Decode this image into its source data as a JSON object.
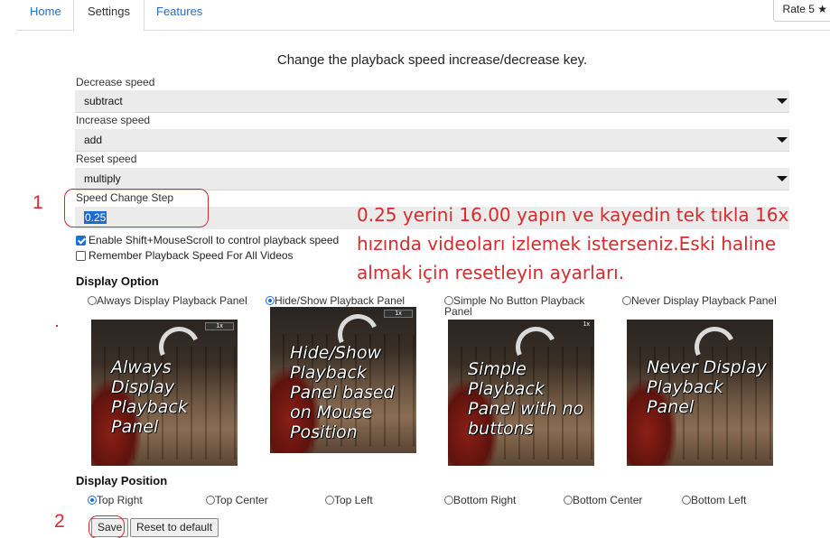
{
  "tabs": [
    {
      "label": "Home"
    },
    {
      "label": "Settings"
    },
    {
      "label": "Features"
    }
  ],
  "rate_button": "Rate 5 ★",
  "heading": "Change the playback speed increase/decrease key.",
  "decrease": {
    "label": "Decrease speed",
    "value": "subtract"
  },
  "increase": {
    "label": "Increase speed",
    "value": "add"
  },
  "reset": {
    "label": "Reset speed",
    "value": "multiply"
  },
  "step": {
    "label": "Speed Change Step",
    "value": "0.25"
  },
  "checkboxes": [
    {
      "label": "Enable Shift+MouseScroll to control playback speed",
      "checked": true
    },
    {
      "label": "Remember Playback Speed For All Videos",
      "checked": false
    }
  ],
  "display_option": {
    "title": "Display Option",
    "options": [
      {
        "label": "Always Display Playback Panel",
        "selected": false,
        "caption": "Always Display Playback Panel"
      },
      {
        "label": "Hide/Show Playback Panel",
        "selected": true,
        "caption": "Hide/Show Playback Panel based on Mouse Position"
      },
      {
        "label": "Simple No Button Playback Panel",
        "selected": false,
        "caption": "Simple Playback Panel with no buttons"
      },
      {
        "label": "Never Display Playback Panel",
        "selected": false,
        "caption": "Never Display Playback Panel"
      }
    ],
    "panel_speed": "1x"
  },
  "display_position": {
    "title": "Display Position",
    "options": [
      {
        "label": "Top Right",
        "selected": true
      },
      {
        "label": "Top Center",
        "selected": false
      },
      {
        "label": "Top Left",
        "selected": false
      },
      {
        "label": "Bottom Right",
        "selected": false
      },
      {
        "label": "Bottom Center",
        "selected": false
      },
      {
        "label": "Bottom Left",
        "selected": false
      }
    ]
  },
  "buttons": {
    "save": "Save",
    "reset": "Reset to default"
  },
  "annotations": {
    "num1": "1",
    "num2": "2",
    "text": "0.25 yerini 16.00 yapın ve kayedin tek tıkla 16x hızında videoları izlemek isterseniz.Eski haline almak için resetleyin ayarları.",
    "color": "#d42b2b"
  }
}
